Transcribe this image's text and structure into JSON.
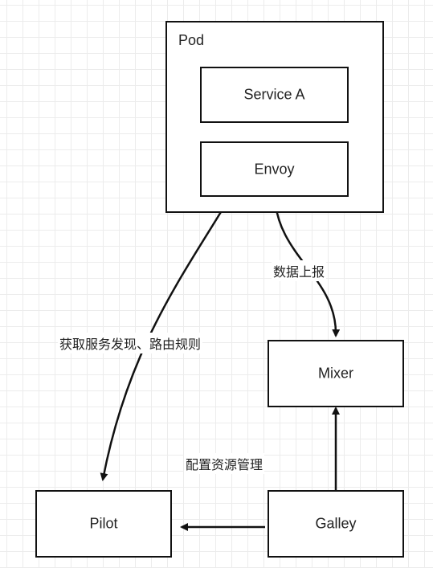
{
  "nodes": {
    "pod": "Pod",
    "service_a": "Service A",
    "envoy": "Envoy",
    "mixer": "Mixer",
    "pilot": "Pilot",
    "galley": "Galley"
  },
  "edges": {
    "envoy_to_mixer": "数据上报",
    "envoy_to_pilot": "获取服务发现、路由规则",
    "galley_config": "配置资源管理"
  }
}
